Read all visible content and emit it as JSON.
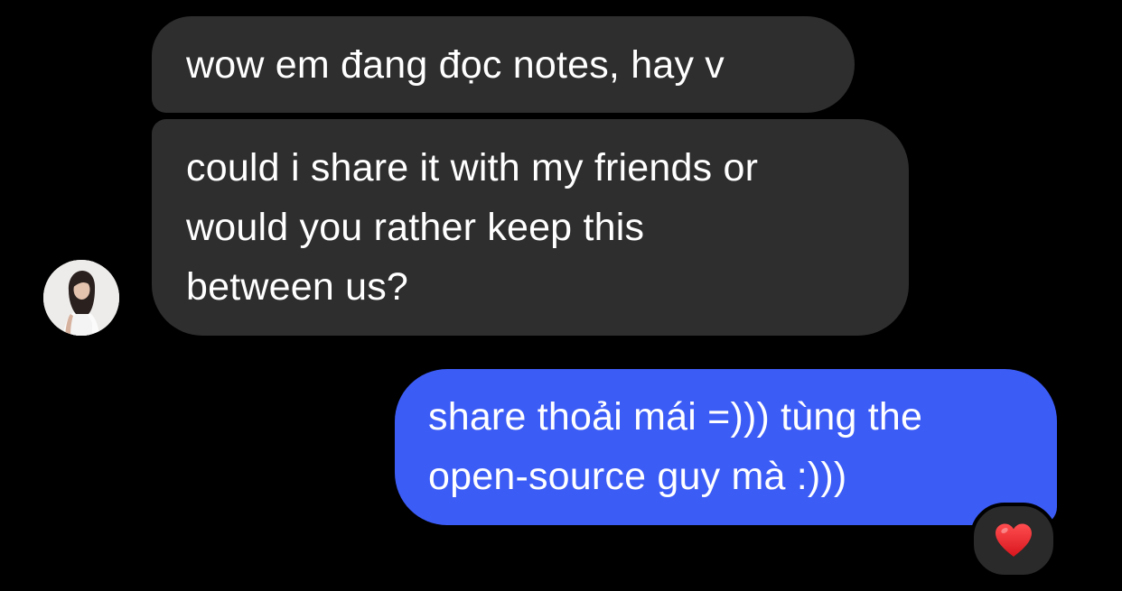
{
  "conversation": {
    "messages": [
      {
        "direction": "incoming",
        "lines": [
          "wow em đang đọc notes, hay v"
        ]
      },
      {
        "direction": "incoming",
        "lines": [
          "could i share it with my friends or",
          "would you rather keep this",
          "between us?"
        ]
      },
      {
        "direction": "outgoing",
        "lines": [
          "share thoải mái =))) tùng the",
          "open-source guy mà :)))"
        ]
      }
    ],
    "reaction": {
      "icon": "heart-icon",
      "emoji": "❤️",
      "color": "#e8202a"
    },
    "avatar": {
      "icon": "contact-avatar"
    }
  },
  "colors": {
    "background": "#000000",
    "incoming_bubble": "#2e2e2e",
    "outgoing_bubble": "#3c5cf6",
    "text": "#ffffff"
  }
}
